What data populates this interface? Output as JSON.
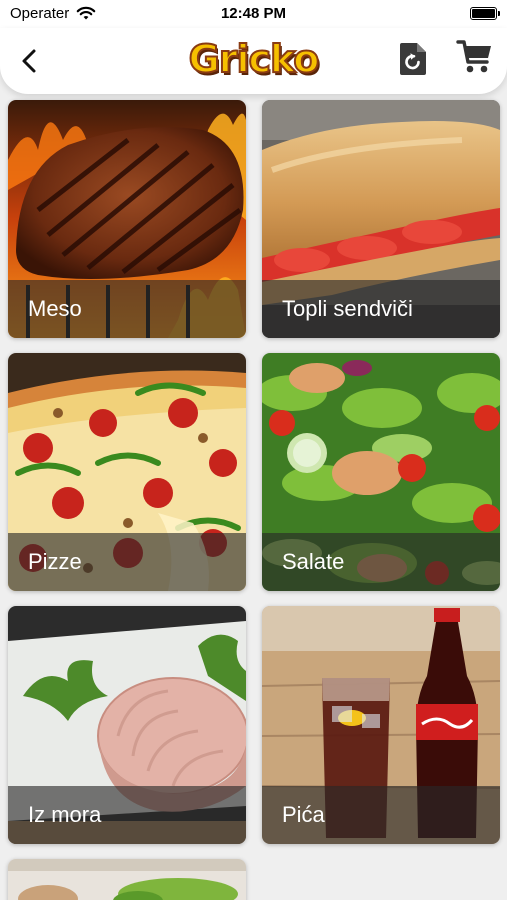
{
  "status_bar": {
    "carrier": "Operater",
    "time": "12:48 PM"
  },
  "header": {
    "logo_text": "Gricko",
    "back_icon": "chevron-left-icon",
    "reorder_icon": "reorder-icon",
    "cart_icon": "cart-icon"
  },
  "categories": [
    {
      "label": "Meso"
    },
    {
      "label": "Topli sendviči"
    },
    {
      "label": "Pizze"
    },
    {
      "label": "Salate"
    },
    {
      "label": "Iz mora"
    },
    {
      "label": "Pića"
    },
    {
      "label": ""
    }
  ],
  "colors": {
    "logo_fill": "#f6c000",
    "logo_outline": "#8a3b12",
    "caption_overlay": "rgba(40,40,40,0.62)",
    "background": "#efefef"
  }
}
